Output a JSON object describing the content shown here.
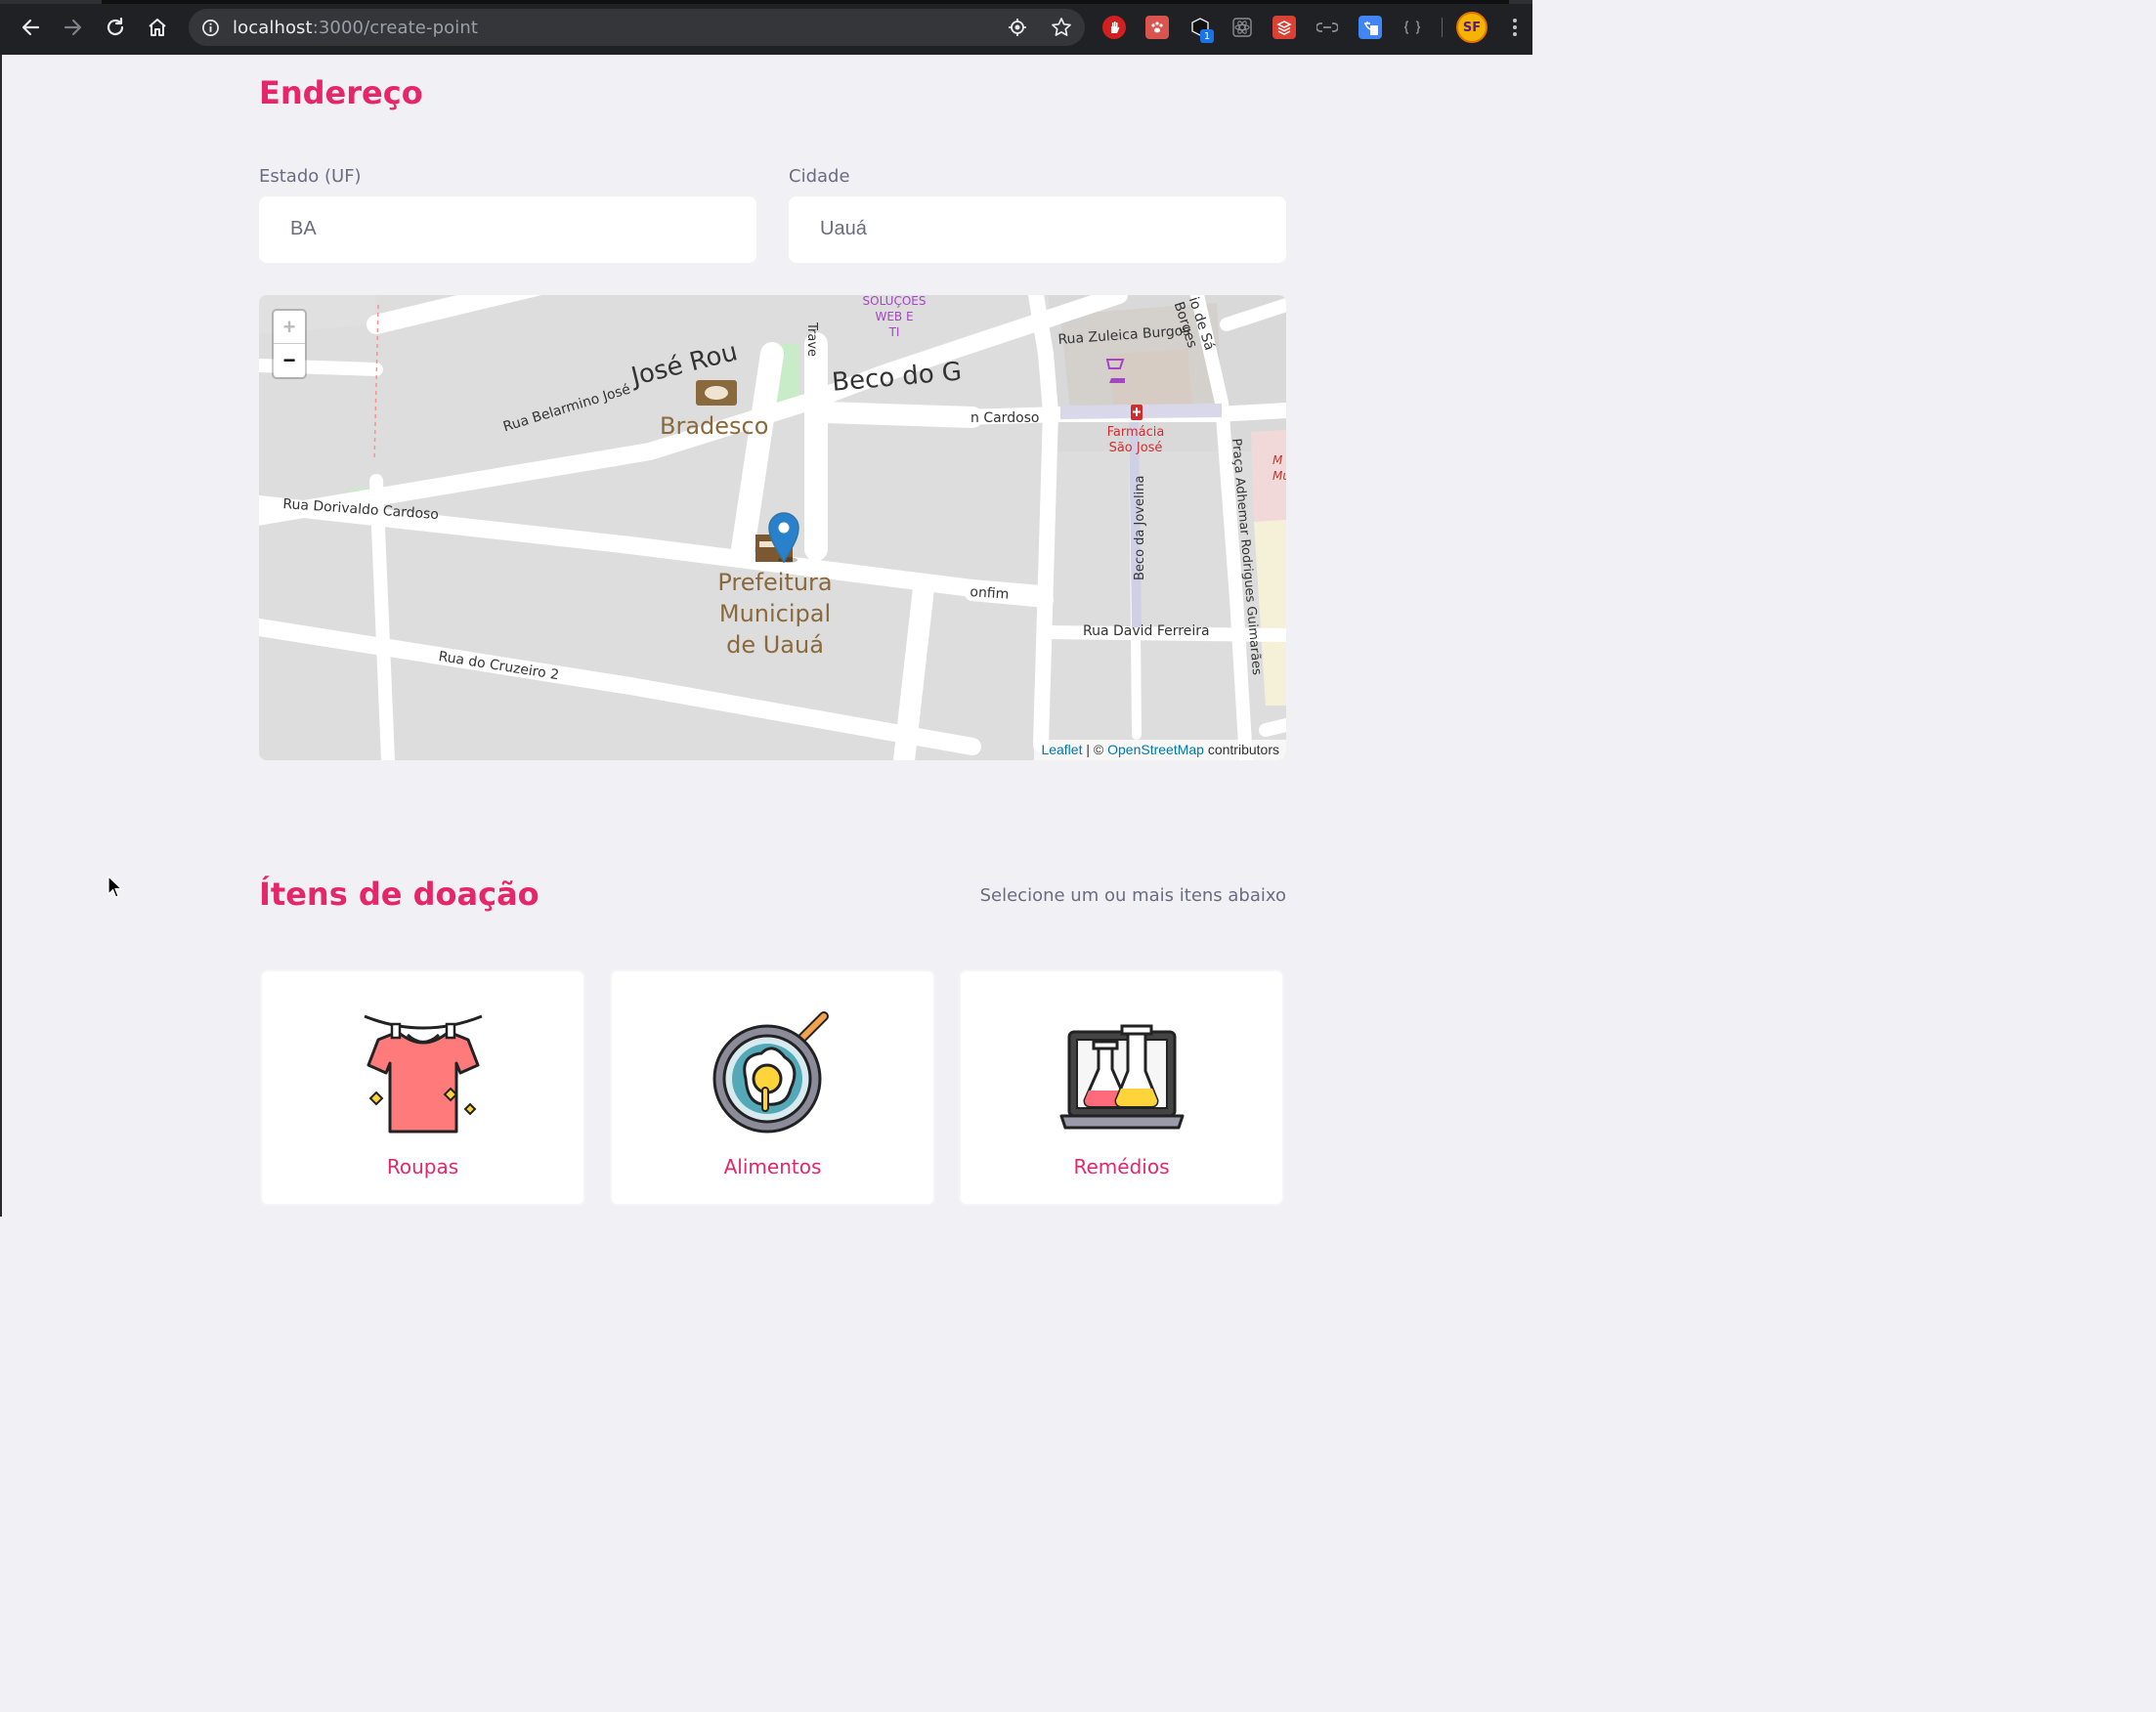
{
  "browser": {
    "url_host": "localhost",
    "url_path": ":3000/create-point",
    "avatar_initials": "SF",
    "extension_badge": "1"
  },
  "address_section": {
    "title": "Endereço",
    "state_label": "Estado (UF)",
    "state_value": "BA",
    "city_label": "Cidade",
    "city_value": "Uauá"
  },
  "map": {
    "zoom_in": "+",
    "zoom_out": "−",
    "attribution_leaflet": "Leaflet",
    "attribution_sep": " | © ",
    "attribution_osm": "OpenStreetMap",
    "attribution_tail": " contributors",
    "labels": {
      "rua_jose": "José Rou",
      "bradesco": "Bradesco",
      "beco": "Beco do G",
      "rua_zuleica": "Rua Zuleica Burgos",
      "sa_borges": "io de Sá Borges",
      "cardoso": "n Cardoso",
      "farmacia_1": "Farmácia",
      "farmacia_2": "São José",
      "solucoes_1": "SOLUÇOES",
      "solucoes_2": "WEB E",
      "solucoes_3": "TI",
      "trave": "Trave",
      "rua_belarmino": "Rua Belarmino José",
      "rua_dorivaldo": "Rua Dorivaldo Cardoso",
      "prefeitura_1": "Prefeitura",
      "prefeitura_2": "Municipal",
      "prefeitura_3": "de Uauá",
      "bonfim": "onfim",
      "rua_david": "Rua David Ferreira",
      "rua_cruzeiro": "Rua do Cruzeiro 2",
      "beco_jovelina": "Beco da Jovelina",
      "praca": "Praça Adhemar Rodrigues Guimarães",
      "right_edge_1": "M",
      "right_edge_2": "Mu"
    }
  },
  "items_section": {
    "title": "Ítens de doação",
    "subtitle": "Selecione um ou mais itens abaixo",
    "items": [
      {
        "label": "Roupas",
        "icon": "tshirt-icon"
      },
      {
        "label": "Alimentos",
        "icon": "fried-egg-pan-icon"
      },
      {
        "label": "Remédios",
        "icon": "lab-flasks-icon"
      }
    ]
  },
  "colors": {
    "accent": "#e5276a",
    "text_muted": "#6c6c80",
    "page_bg": "#f0f0f5"
  }
}
